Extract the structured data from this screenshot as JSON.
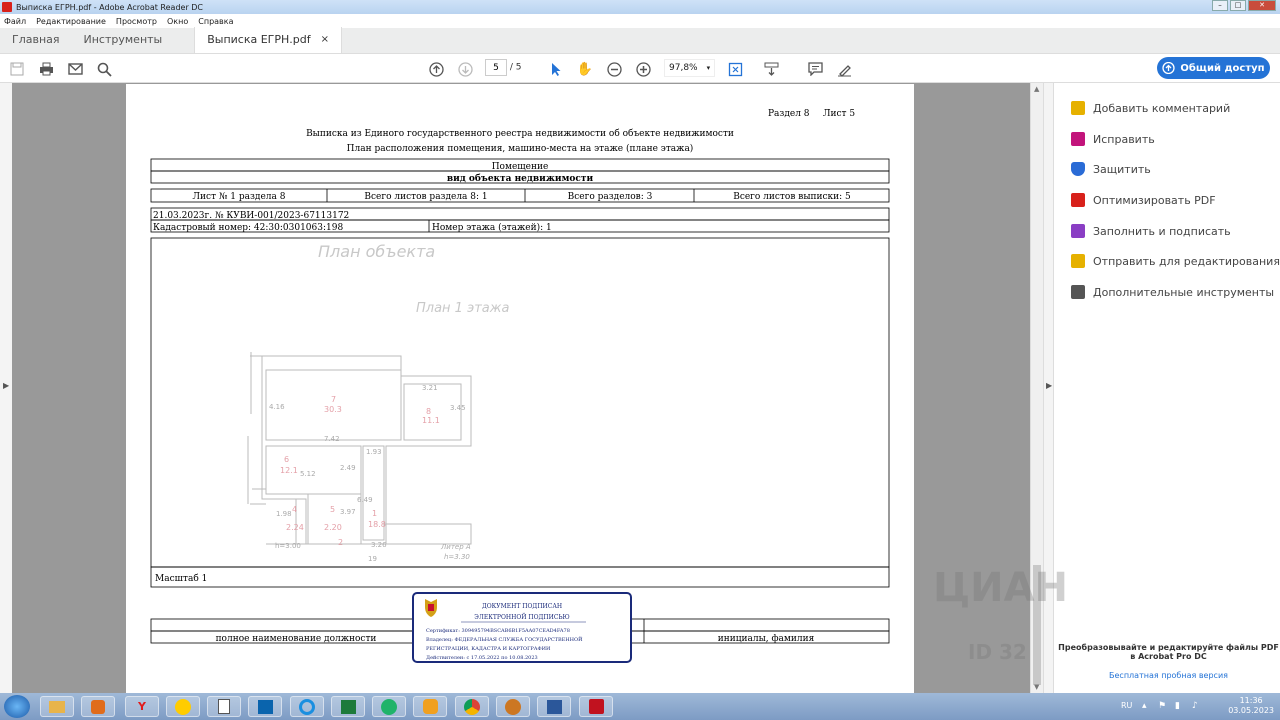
{
  "window": {
    "title": "Выписка ЕГРН.pdf - Adobe Acrobat Reader DC"
  },
  "menu": [
    "Файл",
    "Редактирование",
    "Просмотр",
    "Окно",
    "Справка"
  ],
  "tabs": {
    "home": "Главная",
    "tools": "Инструменты",
    "doc": "Выписка ЕГРН.pdf",
    "close": "×"
  },
  "toolbar": {
    "page_current": "5",
    "page_sep": "/",
    "page_total": "5",
    "zoom": "97,8%",
    "share_label": "Общий доступ"
  },
  "doc": {
    "section": "Раздел 8",
    "sheet": "Лист 5",
    "title": "Выписка из Единого государственного реестра недвижимости об объекте недвижимости",
    "subtitle": "План расположения помещения, машино-места на этаже (плане этажа)",
    "row_premises": "Помещение",
    "row_kind": "вид объекта недвижимости",
    "cells": [
      "Лист № 1 раздела 8",
      "Всего листов раздела 8: 1",
      "Всего разделов: 3",
      "Всего листов выписки: 5"
    ],
    "date_line": "21.03.2023г. № КУВИ-001/2023-67113172",
    "cad_num": "Кадастровый номер: 42:30:0301063:198",
    "floor_num": "Номер этажа (этажей): 1",
    "plan_title": "План объекта",
    "plan_floor": "План 1 этажа",
    "plan_labels": [
      "7",
      "30.3",
      "8",
      "11.1",
      "6",
      "12.1",
      "1",
      "18.8",
      "4",
      "2.24",
      "5",
      "2.20",
      "2",
      "3.21",
      "3.45",
      "4.16",
      "7.42",
      "1.93",
      "5.12",
      "2.49",
      "6.49",
      "3.97",
      "1.98",
      "3.26",
      "h=3.00",
      "Литер А",
      "h=3.30",
      "19"
    ],
    "scale": "Масштаб 1",
    "position_label": "полное наименование должности",
    "name_label": "инициалы, фамилия",
    "stamp": {
      "l1": "ДОКУМЕНТ ПОДПИСАН",
      "l2": "ЭЛЕКТРОННОЙ ПОДПИСЬЮ",
      "cert": "Сертификат: 309495794BSCAB6B1F5AA07CEAD4FA78",
      "owner1": "Владелец: ФЕДЕРАЛЬНАЯ СЛУЖБА ГОСУДАРСТВЕННОЙ",
      "owner2": "РЕГИСТРАЦИИ, КАДАСТРА И КАРТОГРАФИИ",
      "valid": "Действителен: с 17.05.2022 по 10.08.2023"
    }
  },
  "right_panel": {
    "tools": [
      "Добавить комментарий",
      "Исправить",
      "Защитить",
      "Оптимизировать PDF",
      "Заполнить и подписать",
      "Отправить для редактирования",
      "Дополнительные инструменты"
    ],
    "tool_colors": [
      "#e6b100",
      "#c2147b",
      "#2a6bd6",
      "#d8211b",
      "#8a3ec4",
      "#e6b100",
      "#555555"
    ],
    "promo1": "Преобразовывайте и редактируйте файлы PDF",
    "promo2": "в Acrobat Pro DC",
    "trial": "Бесплатная пробная версия"
  },
  "watermark": {
    "brand": "ЦИАН",
    "id": "ID 32"
  },
  "taskbar": {
    "apps": [
      "Folder",
      "Media",
      "Y",
      "1С",
      "Doc",
      "Outlook",
      "IE",
      "Excel",
      "WA",
      "Bell",
      "Chrome",
      "Edu",
      "Word",
      "PDF"
    ],
    "app_colors": [
      "#e8b44a",
      "#e06c1b",
      "#e21b1b",
      "#ffcc00",
      "#888888",
      "#0a64ad",
      "#1a8fe0",
      "#1d7a3b",
      "#20b36a",
      "#f0a020",
      "#db4437",
      "#cc7722",
      "#2b579a",
      "#c1121f"
    ],
    "lang": "RU",
    "time": "11:36",
    "date": "03.05.2023"
  }
}
